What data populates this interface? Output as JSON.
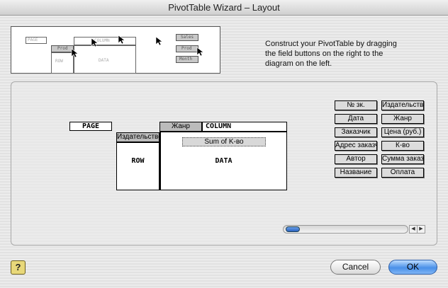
{
  "window": {
    "title": "PivotTable Wizard – Layout"
  },
  "preview": {
    "page_label": "PAGE",
    "row_field_label": "Prod",
    "col_label": "COLUMN",
    "row_label": "ROW",
    "data_label": "DATA",
    "side_buttons": [
      "Sales",
      "Prod",
      "Month"
    ]
  },
  "instructions": "Construct your PivotTable by dragging the field buttons on the right to the diagram on the left.",
  "layout": {
    "page_label": "PAGE",
    "row_label": "ROW",
    "column_label": "COLUMN",
    "data_label": "DATA",
    "row_field": "Издательство",
    "column_field": "Жанр",
    "data_field": "Sum of K-во"
  },
  "field_buttons": [
    "№ зк.",
    "Издательство",
    "Дата",
    "Жанр",
    "Заказчик",
    "Цена (руб.)",
    "Адрес заказчика",
    "К-во",
    "Автор",
    "Сумма заказа",
    "Название",
    "Оплата"
  ],
  "buttons": {
    "help": "?",
    "cancel": "Cancel",
    "ok": "OK"
  }
}
